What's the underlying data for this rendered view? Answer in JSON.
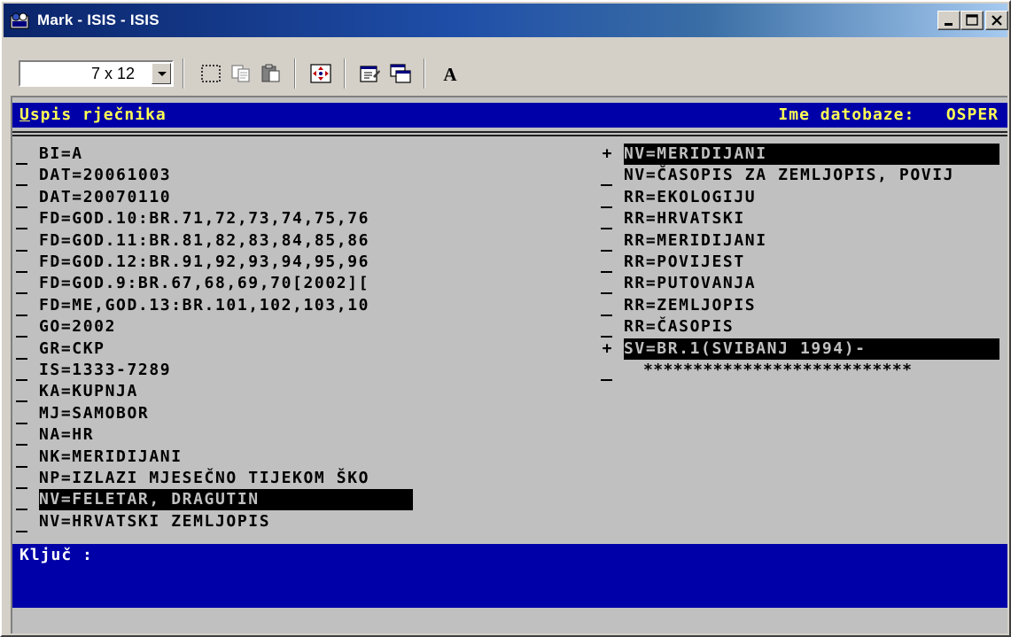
{
  "window": {
    "title": "Mark - ISIS - ISIS"
  },
  "toolbar": {
    "font_size_value": "7 x 12",
    "buttons": [
      "select-icon",
      "copy-icon",
      "paste-icon",
      "fullscreen-icon",
      "properties-icon",
      "background-icon",
      "font-icon"
    ]
  },
  "console": {
    "header_title_first": "U",
    "header_title_rest": "spis rječnika",
    "header_db_label": "Ime datobaze:",
    "header_db_name": "OSPER",
    "left_entries": [
      "BI=A",
      "DAT=20061003",
      "DAT=20070110",
      "FD=GOD.10:BR.71,72,73,74,75,76",
      "FD=GOD.11:BR.81,82,83,84,85,86",
      "FD=GOD.12:BR.91,92,93,94,95,96",
      "FD=GOD.9:BR.67,68,69,70[2002][",
      "FD=ME,GOD.13:BR.101,102,103,10",
      "GO=2002",
      "GR=CKP",
      "IS=1333-7289",
      "KA=KUPNJA",
      "MJ=SAMOBOR",
      "NA=HR",
      "NK=MERIDIJANI",
      "NP=IZLAZI MJESEČNO TIJEKOM ŠKO",
      "NV=FELETAR, DRAGUTIN",
      "NV=HRVATSKI ZEMLJOPIS"
    ],
    "right_entries": [
      "NV=MERIDIJANI",
      "NV=ČASOPIS ZA ZEMLJOPIS, POVIJ",
      "RR=EKOLOGIJU",
      "RR=HRVATSKI",
      "RR=MERIDIJANI",
      "RR=POVIJEST",
      "RR=PUTOVANJA",
      "RR=ZEMLJOPIS",
      "RR=ČASOPIS",
      "SV=BR.1(SVIBANJ 1994)-",
      "***************************"
    ],
    "right_markers": [
      "+",
      "_",
      "_",
      "_",
      "_",
      "_",
      "_",
      "_",
      "_",
      "+",
      "_"
    ],
    "footer_prompt": "Ključ :"
  }
}
